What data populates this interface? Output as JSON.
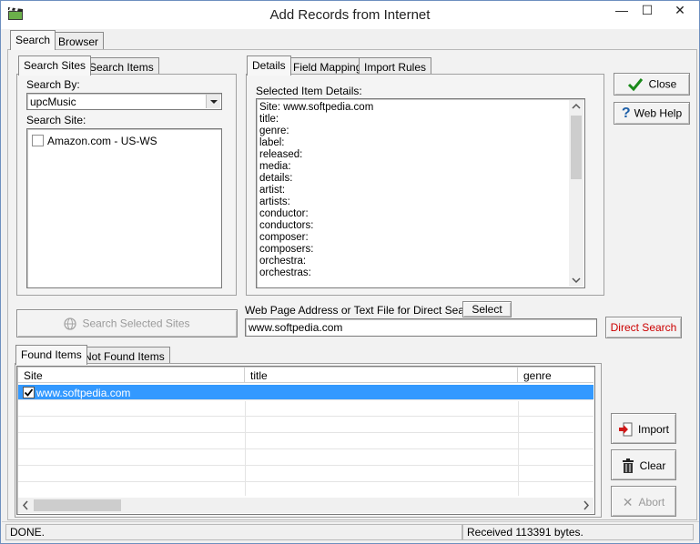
{
  "window": {
    "title": "Add Records from Internet",
    "controls": {
      "minimize": "—",
      "maximize": "☐",
      "close": "✕"
    }
  },
  "main_tabs": [
    {
      "label": "Search"
    },
    {
      "label": "Browser"
    }
  ],
  "left_tabs": [
    {
      "label": "Search Sites"
    },
    {
      "label": "Search Items"
    }
  ],
  "search_by": {
    "label": "Search By:",
    "value": "upcMusic"
  },
  "search_site": {
    "label": "Search Site:",
    "items": [
      {
        "label": "Amazon.com - US-WS",
        "checked": false
      }
    ]
  },
  "details_tabs": [
    {
      "label": "Details"
    },
    {
      "label": "Field Mapping"
    },
    {
      "label": "Import Rules"
    }
  ],
  "details": {
    "label": "Selected Item Details:",
    "lines": [
      "Site: www.softpedia.com",
      "title:",
      "genre:",
      "label:",
      "released:",
      "media:",
      "details:",
      "artist:",
      "artists:",
      "conductor:",
      "conductors:",
      "composer:",
      "composers:",
      "orchestra:",
      "orchestras:"
    ]
  },
  "buttons": {
    "close": "Close",
    "web_help": "Web Help",
    "search_selected_sites": "Search Selected Sites",
    "select": "Select",
    "direct_search": "Direct Search",
    "import": "Import",
    "clear": "Clear",
    "abort": "Abort"
  },
  "direct": {
    "label": "Web Page Address or Text File for Direct Search:",
    "value": "www.softpedia.com"
  },
  "results_tabs": [
    {
      "label": "Found Items"
    },
    {
      "label": "Not Found Items"
    }
  ],
  "results": {
    "columns": [
      "Site",
      "title",
      "genre"
    ],
    "rows": [
      {
        "site": "www.softpedia.com",
        "title": "",
        "genre": "",
        "checked": true,
        "selected": true
      }
    ]
  },
  "status": {
    "left": "DONE.",
    "right": "Received 113391 bytes."
  },
  "colors": {
    "selection": "#3399ff",
    "direct_search_text": "#cc0000",
    "close_check": "#1a8a1a",
    "help_mark": "#1d5fa8"
  }
}
